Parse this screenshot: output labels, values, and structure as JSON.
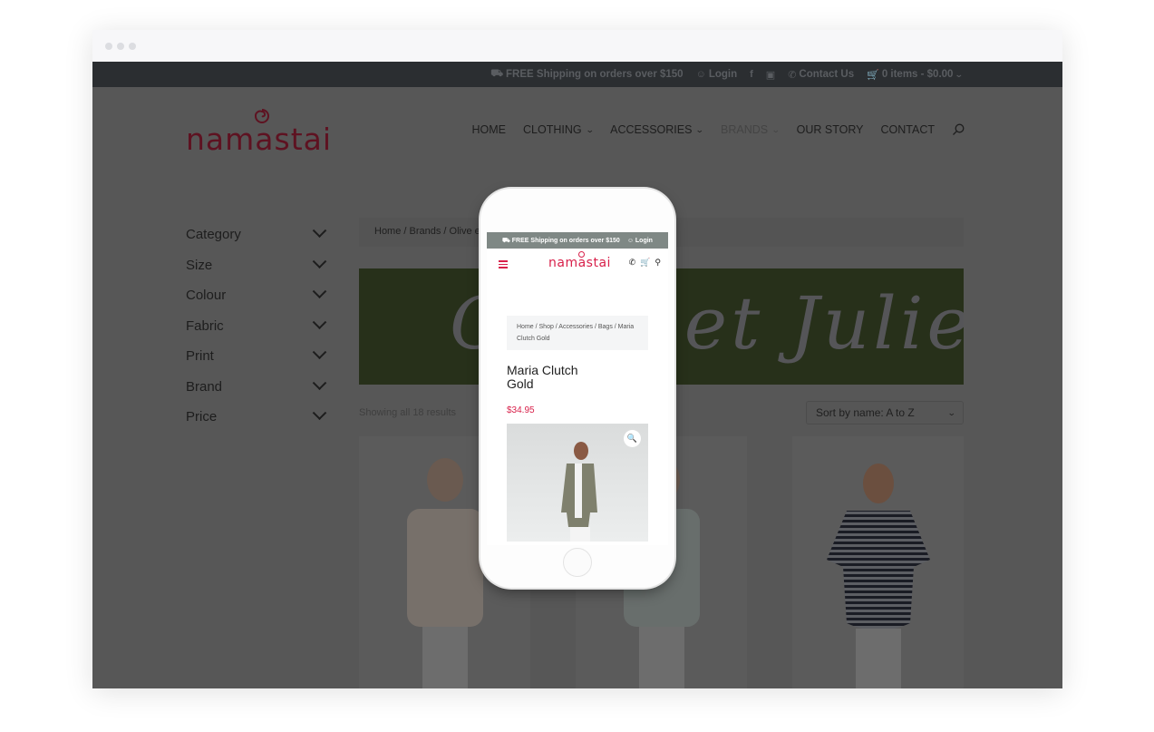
{
  "browser": {
    "window_dots": 3
  },
  "topbar": {
    "shipping": "FREE Shipping on orders over $150",
    "login": "Login",
    "contact": "Contact Us",
    "cart": "0 items - $0.00",
    "icons": [
      "truck-icon",
      "user-icon",
      "facebook-icon",
      "instagram-icon",
      "phone-icon",
      "cart-icon",
      "chevron-down-icon"
    ]
  },
  "logo": {
    "text": "namastai",
    "color": "#5e1221"
  },
  "nav": {
    "items": [
      {
        "label": "HOME",
        "dropdown": false
      },
      {
        "label": "CLOTHING",
        "dropdown": true
      },
      {
        "label": "ACCESSORIES",
        "dropdown": true
      },
      {
        "label": "BRANDS",
        "dropdown": true,
        "active": true
      },
      {
        "label": "OUR STORY",
        "dropdown": false
      },
      {
        "label": "CONTACT",
        "dropdown": false
      }
    ],
    "search_icon": "search-icon"
  },
  "sidebar": {
    "filters": [
      "Category",
      "Size",
      "Colour",
      "Fabric",
      "Print",
      "Brand",
      "Price"
    ]
  },
  "main": {
    "breadcrumb": "Home / Brands / Olive et Julie",
    "banner_title": "Olive et Julie",
    "banner_color": "#27301a",
    "result_count": "Showing all 18 results",
    "sort": {
      "selected": "Sort by name: A to Z"
    },
    "products": [
      {
        "name": "knit-jumper-beige"
      },
      {
        "name": "knit-jumper-grey"
      },
      {
        "name": "striped-top-navy"
      }
    ]
  },
  "phone": {
    "topbar_shipping": "FREE Shipping on orders over $150",
    "topbar_login": "Login",
    "logo": "namastai",
    "brand_color": "#d8204a",
    "breadcrumb": "Home / Shop / Accessories / Bags / Maria Clutch Gold",
    "product_title": "Maria Clutch Gold",
    "price": "$34.95"
  }
}
